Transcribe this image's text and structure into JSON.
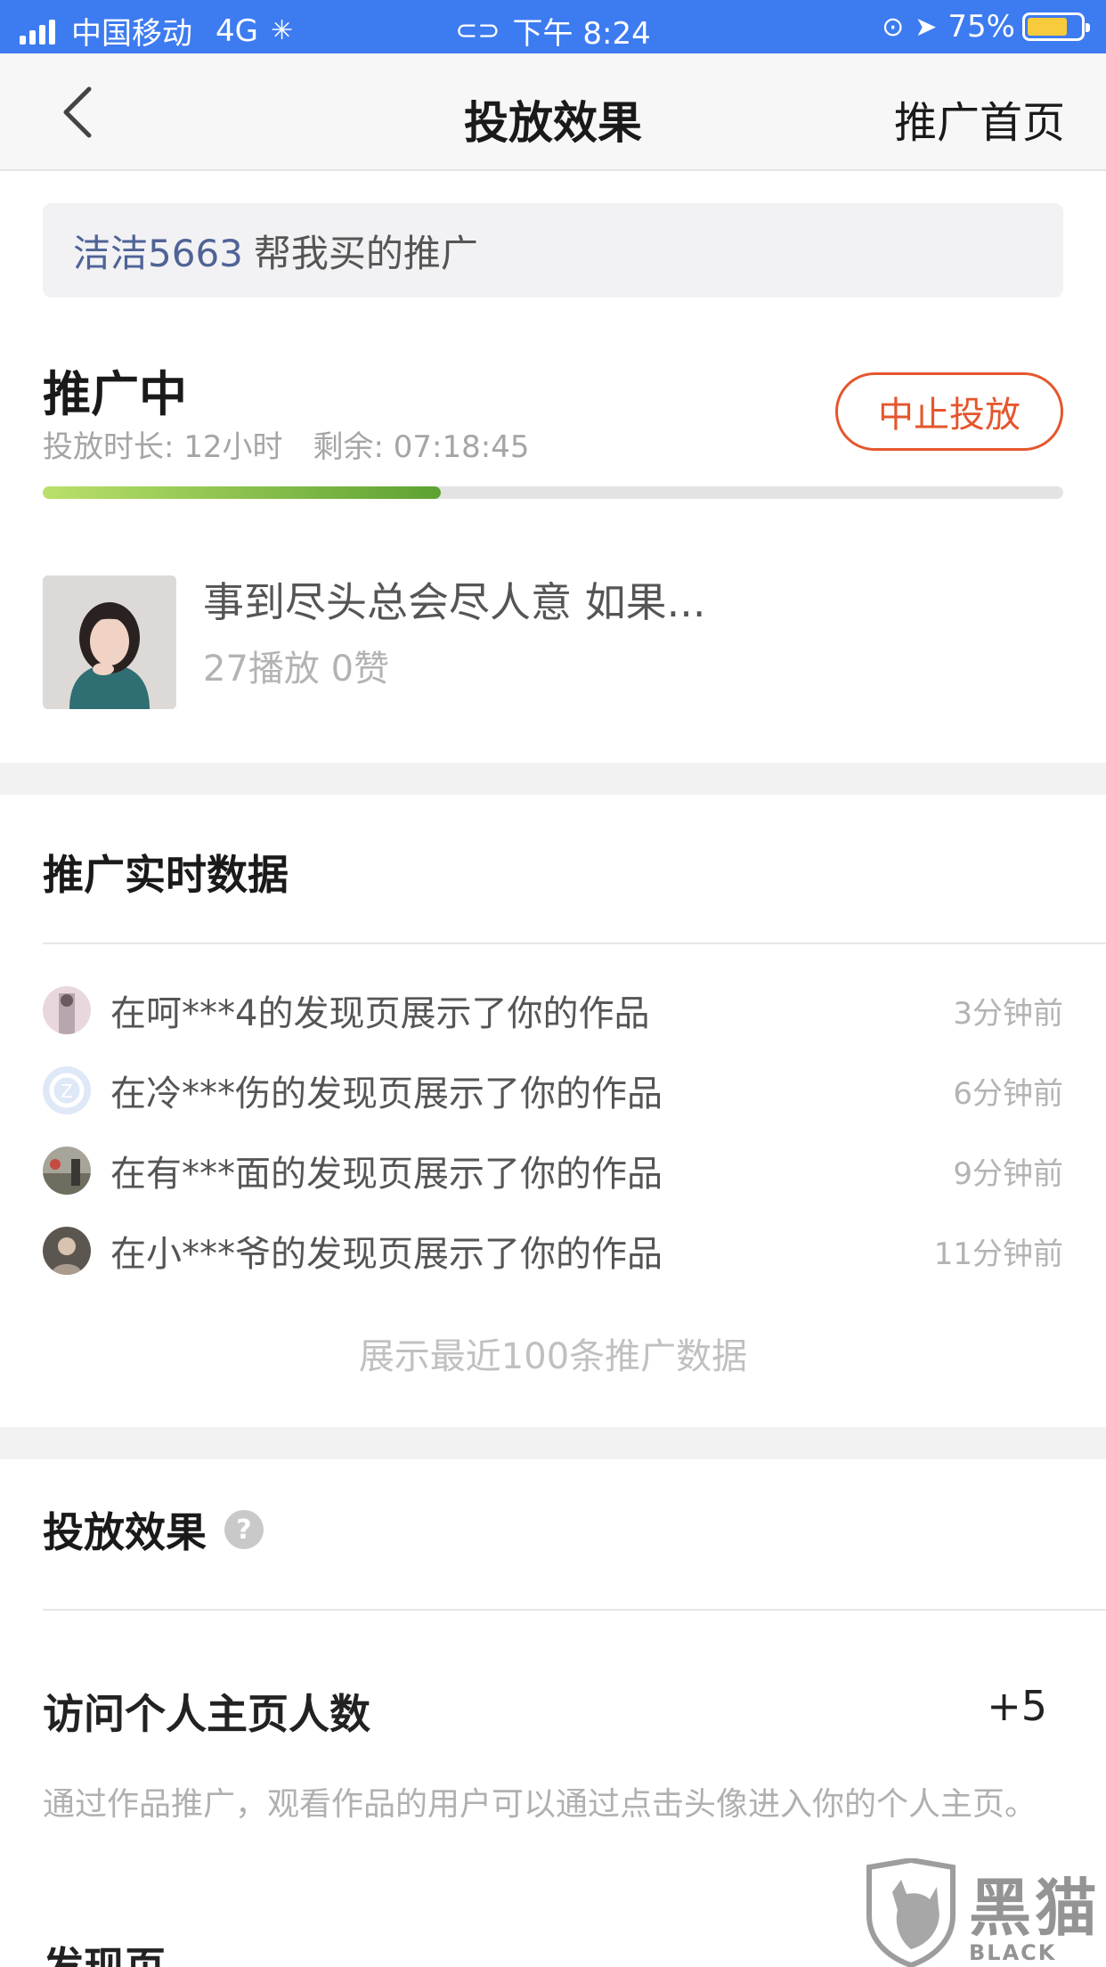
{
  "status_bar": {
    "carrier": "中国移动",
    "network": "4G",
    "time": "下午 8:24",
    "battery": "75%",
    "battery_level": 0.75
  },
  "nav": {
    "title": "投放效果",
    "home_label": "推广首页"
  },
  "buyer": {
    "name": "洁洁5663",
    "suffix": "帮我买的推广"
  },
  "promotion": {
    "status": "推广中",
    "duration": "投放时长: 12小时",
    "remaining": "剩余: 07:18:45",
    "stop_label": "中止投放",
    "progress": 0.39
  },
  "video": {
    "title": "事到尽头总会尽人意 如果...",
    "stats": "27播放  0赞"
  },
  "realtime": {
    "title": "推广实时数据",
    "items": [
      {
        "text": "在呵***4的发现页展示了你的作品",
        "time": "3分钟前"
      },
      {
        "text": "在冷***伤的发现页展示了你的作品",
        "time": "6分钟前"
      },
      {
        "text": "在有***面的发现页展示了你的作品",
        "time": "9分钟前"
      },
      {
        "text": "在小***爷的发现页展示了你的作品",
        "time": "11分钟前"
      }
    ],
    "footer": "展示最近100条推广数据"
  },
  "effect": {
    "title": "投放效果",
    "help_icon": "?",
    "metric_label": "访问个人主页人数",
    "metric_value": "+5",
    "metric_desc": "通过作品推广，观看作品的用户可以通过点击头像进入你的个人主页。",
    "next_section": "发现页"
  },
  "watermark": {
    "text": "黑猫",
    "sub": "BLACK CAT"
  },
  "colors": {
    "status_bar": "#3d7bf0",
    "accent": "#e5562d",
    "progress": "#5ea232",
    "buyer_name": "#4f6396"
  }
}
